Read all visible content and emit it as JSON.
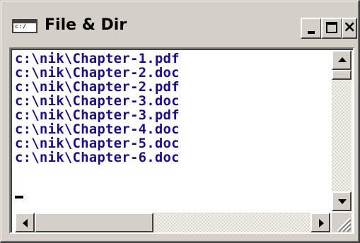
{
  "window": {
    "title": "File & Dir",
    "icon": "console-window-icon",
    "icon_text": "c:/"
  },
  "controls": {
    "minimize_icon": "minimize-icon",
    "maximize_icon": "maximize-icon",
    "close_icon": "close-icon",
    "close_glyph": "×"
  },
  "content": {
    "lines": [
      "c:\\nik\\Chapter-1.pdf",
      "c:\\nik\\Chapter-2.doc",
      "c:\\nik\\Chapter-2.pdf",
      "c:\\nik\\Chapter-3.doc",
      "c:\\nik\\Chapter-3.pdf",
      "c:\\nik\\Chapter-4.doc",
      "c:\\nik\\Chapter-5.doc",
      "c:\\nik\\Chapter-6.doc"
    ]
  },
  "colors": {
    "text": "#1a0e8c",
    "face": "#d4d0c8",
    "background": "#ffffff"
  }
}
